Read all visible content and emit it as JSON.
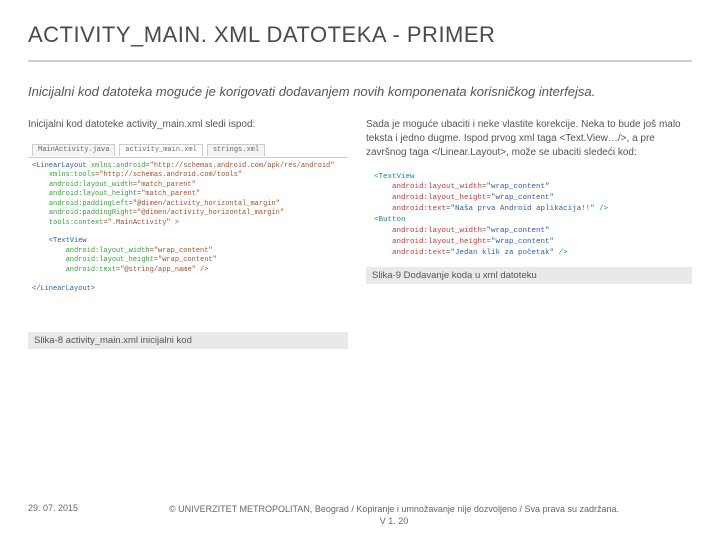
{
  "title": "ACTIVITY_MAIN. XML DATOTEKA - PRIMER",
  "intro": "Inicijalni kod datoteka moguće je korigovati dodavanjem novih komponenata korisničkog interfejsa.",
  "left": {
    "para": "Inicijalni kod datoteke activity_main.xml sledi ispod:",
    "tabs": [
      "MainActivity.java",
      "activity_main.xml",
      "strings.xml"
    ],
    "code": {
      "l1a": "<LinearLayout ",
      "l1b": "xmlns:android",
      "l1c": "=\"http://schemas.android.com/apk/res/android\"",
      "l2a": "    ",
      "l2b": "xmlns:tools",
      "l2c": "=\"http://schemas.android.com/tools\"",
      "l3a": "    ",
      "l3b": "android:layout_width",
      "l3c": "=\"match_parent\"",
      "l4a": "    ",
      "l4b": "android:layout_height",
      "l4c": "=\"match_parent\"",
      "l5a": "    ",
      "l5b": "android:paddingLeft",
      "l5c": "=\"@dimen/activity_horizontal_margin\"",
      "l6a": "    ",
      "l6b": "android:paddingRight",
      "l6c": "=\"@dimen/activity_horizontal_margin\"",
      "l7a": "    ",
      "l7b": "tools:context",
      "l7c": "=\".MainActivity\" >",
      "l8": " ",
      "l9": "    <TextView",
      "l10a": "        ",
      "l10b": "android:layout_width",
      "l10c": "=\"wrap_content\"",
      "l11a": "        ",
      "l11b": "android:layout_height",
      "l11c": "=\"wrap_content\"",
      "l12a": "        ",
      "l12b": "android:text",
      "l12c": "=\"@string/app_name\" />",
      "l13": " ",
      "l14": "</LinearLayout>"
    },
    "caption": "Slika-8 activity_main.xml inicijalni kod"
  },
  "right": {
    "para": "Sada je moguće ubaciti i neke vlastite korekcije. Neka to bude još malo teksta i jedno dugme. Ispod prvog xml taga <Text.View…/>, a pre završnog taga </Linear.Layout>, može se ubaciti sledeći kod:",
    "code": {
      "l1": "<TextView",
      "l2a": "    ",
      "l2b": "android:layout_width",
      "l2c": "=",
      "l2d": "\"wrap_content\"",
      "l3a": "    ",
      "l3b": "android:layout_height",
      "l3c": "=",
      "l3d": "\"wrap_content\"",
      "l4a": "    ",
      "l4b": "android:text",
      "l4c": "=",
      "l4d": "\"Naša prva Android aplikacija!!\"",
      "l4e": " />",
      "l5": "<Button",
      "l6a": "    ",
      "l6b": "android:layout_width",
      "l6c": "=",
      "l6d": "\"wrap_content\"",
      "l7a": "    ",
      "l7b": "android:layout_height",
      "l7c": "=",
      "l7d": "\"wrap_content\"",
      "l8a": "    ",
      "l8b": "android:text",
      "l8c": "=",
      "l8d": "\"Jedan klik za početak\"",
      "l8e": " />"
    },
    "caption": "Slika-9 Dodavanje koda u xml datoteku"
  },
  "footer": {
    "date": "29. 07. 2015",
    "copy_line1": "© UNIVERZITET METROPOLITAN, Beograd / Kopiranje i umnožavanje nije dozvoljeno / Sva prava su zadržana.",
    "copy_line2": "V 1. 20"
  }
}
